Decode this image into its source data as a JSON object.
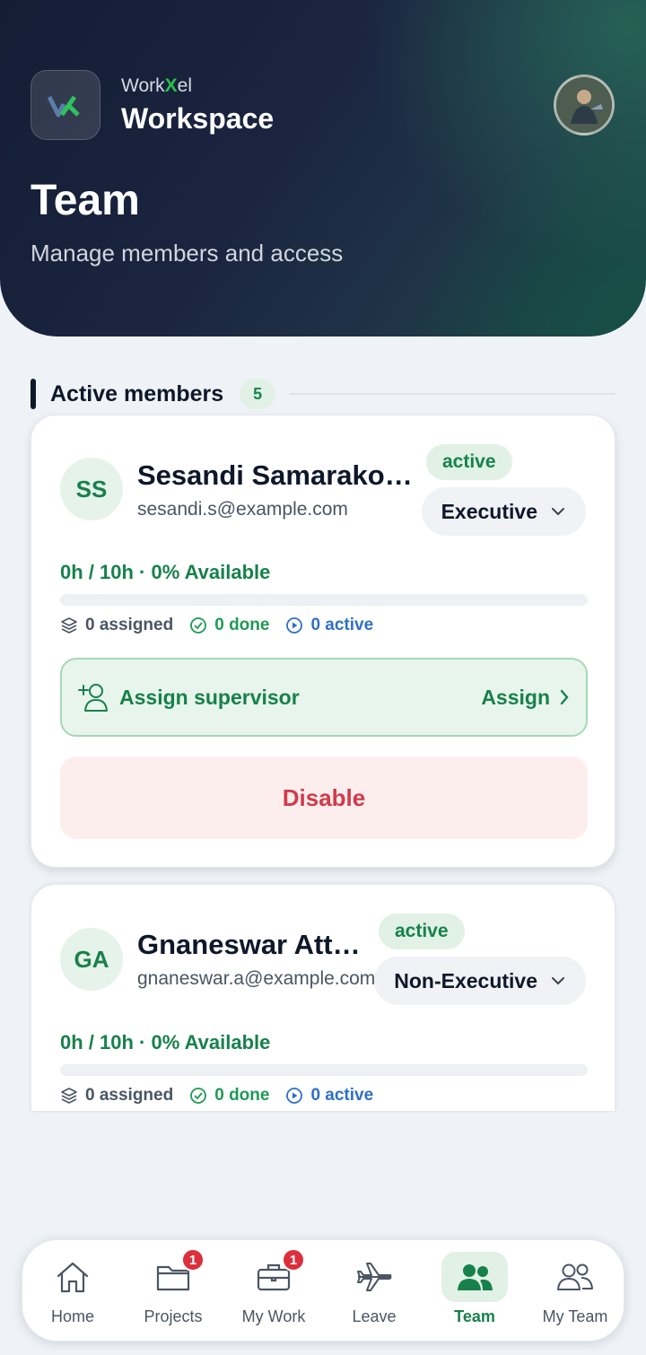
{
  "header": {
    "brand_prefix": "Work",
    "brand_x": "X",
    "brand_suffix": "el",
    "workspace": "Workspace",
    "title": "Team",
    "subtitle": "Manage members and access"
  },
  "section": {
    "title": "Active members",
    "count": "5"
  },
  "members": [
    {
      "initials": "SS",
      "name": "Sesandi Samarakoon",
      "email": "sesandi.s@example.com",
      "status": "active",
      "role": "Executive",
      "availability": "0h / 10h · 0% Available",
      "availability_fraction": 0,
      "assigned": "0 assigned",
      "done": "0 done",
      "active": "0 active",
      "assign_label": "Assign supervisor",
      "assign_action": "Assign",
      "disable_label": "Disable"
    },
    {
      "initials": "GA",
      "name": "Gnaneswar Attu...",
      "email": "gnaneswar.a@example.com",
      "status": "active",
      "role": "Non-Executive",
      "availability": "0h / 10h · 0% Available",
      "availability_fraction": 0,
      "assigned": "0 assigned",
      "done": "0 done",
      "active": "0 active"
    }
  ],
  "tabs": [
    {
      "label": "Home",
      "icon": "home-icon",
      "badge": null
    },
    {
      "label": "Projects",
      "icon": "folder-icon",
      "badge": "1"
    },
    {
      "label": "My Work",
      "icon": "briefcase-icon",
      "badge": "1"
    },
    {
      "label": "Leave",
      "icon": "plane-icon",
      "badge": null
    },
    {
      "label": "Team",
      "icon": "team-icon",
      "badge": null,
      "active": true
    },
    {
      "label": "My Team",
      "icon": "users-icon",
      "badge": null
    }
  ],
  "colors": {
    "accent": "#17814b",
    "danger": "#d23a4a",
    "info": "#2f6fc4"
  }
}
